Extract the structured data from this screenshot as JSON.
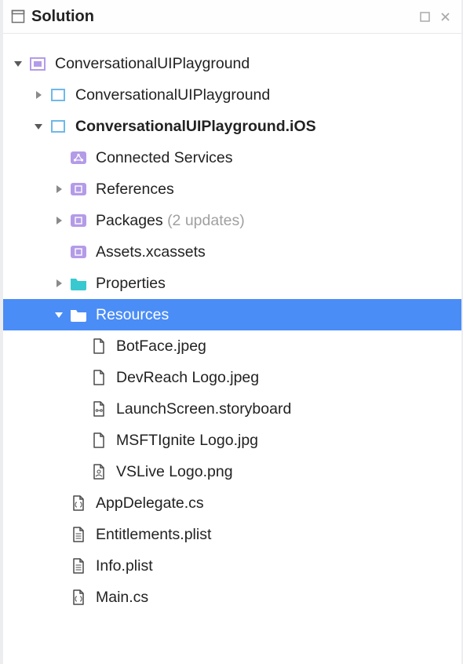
{
  "header": {
    "title": "Solution"
  },
  "colors": {
    "purple": "#b49be8",
    "teal": "#37c9cf",
    "folderWhite": "#ffffff",
    "pageStroke": "#4a4a4a",
    "selectedBg": "#4b8df6",
    "solutionFill": "#ffffff",
    "solutionStroke": "#808080"
  },
  "tree": {
    "root": {
      "label": "ConversationalUIPlayground",
      "expanded": true,
      "children": [
        {
          "label": "ConversationalUIPlayground",
          "kind": "project",
          "expanded": false
        },
        {
          "label": "ConversationalUIPlayground.iOS",
          "kind": "project",
          "bold": true,
          "expanded": true,
          "children": [
            {
              "label": "Connected Services",
              "kind": "purple-conn"
            },
            {
              "label": "References",
              "kind": "purple-box",
              "hasChildren": true,
              "expanded": false
            },
            {
              "label": "Packages",
              "suffix": "(2 updates)",
              "kind": "purple-box",
              "hasChildren": true,
              "expanded": false
            },
            {
              "label": "Assets.xcassets",
              "kind": "purple-box"
            },
            {
              "label": "Properties",
              "kind": "teal-folder",
              "hasChildren": true,
              "expanded": false
            },
            {
              "label": "Resources",
              "kind": "white-folder",
              "hasChildren": true,
              "expanded": true,
              "selected": true,
              "children": [
                {
                  "label": "BotFace.jpeg",
                  "kind": "file"
                },
                {
                  "label": "DevReach Logo.jpeg",
                  "kind": "file"
                },
                {
                  "label": "LaunchScreen.storyboard",
                  "kind": "storyboard"
                },
                {
                  "label": "MSFTIgnite Logo.jpg",
                  "kind": "file"
                },
                {
                  "label": "VSLive Logo.png",
                  "kind": "file-image"
                }
              ]
            },
            {
              "label": "AppDelegate.cs",
              "kind": "cs"
            },
            {
              "label": "Entitlements.plist",
              "kind": "plist"
            },
            {
              "label": "Info.plist",
              "kind": "plist"
            },
            {
              "label": "Main.cs",
              "kind": "cs"
            }
          ]
        }
      ]
    }
  }
}
